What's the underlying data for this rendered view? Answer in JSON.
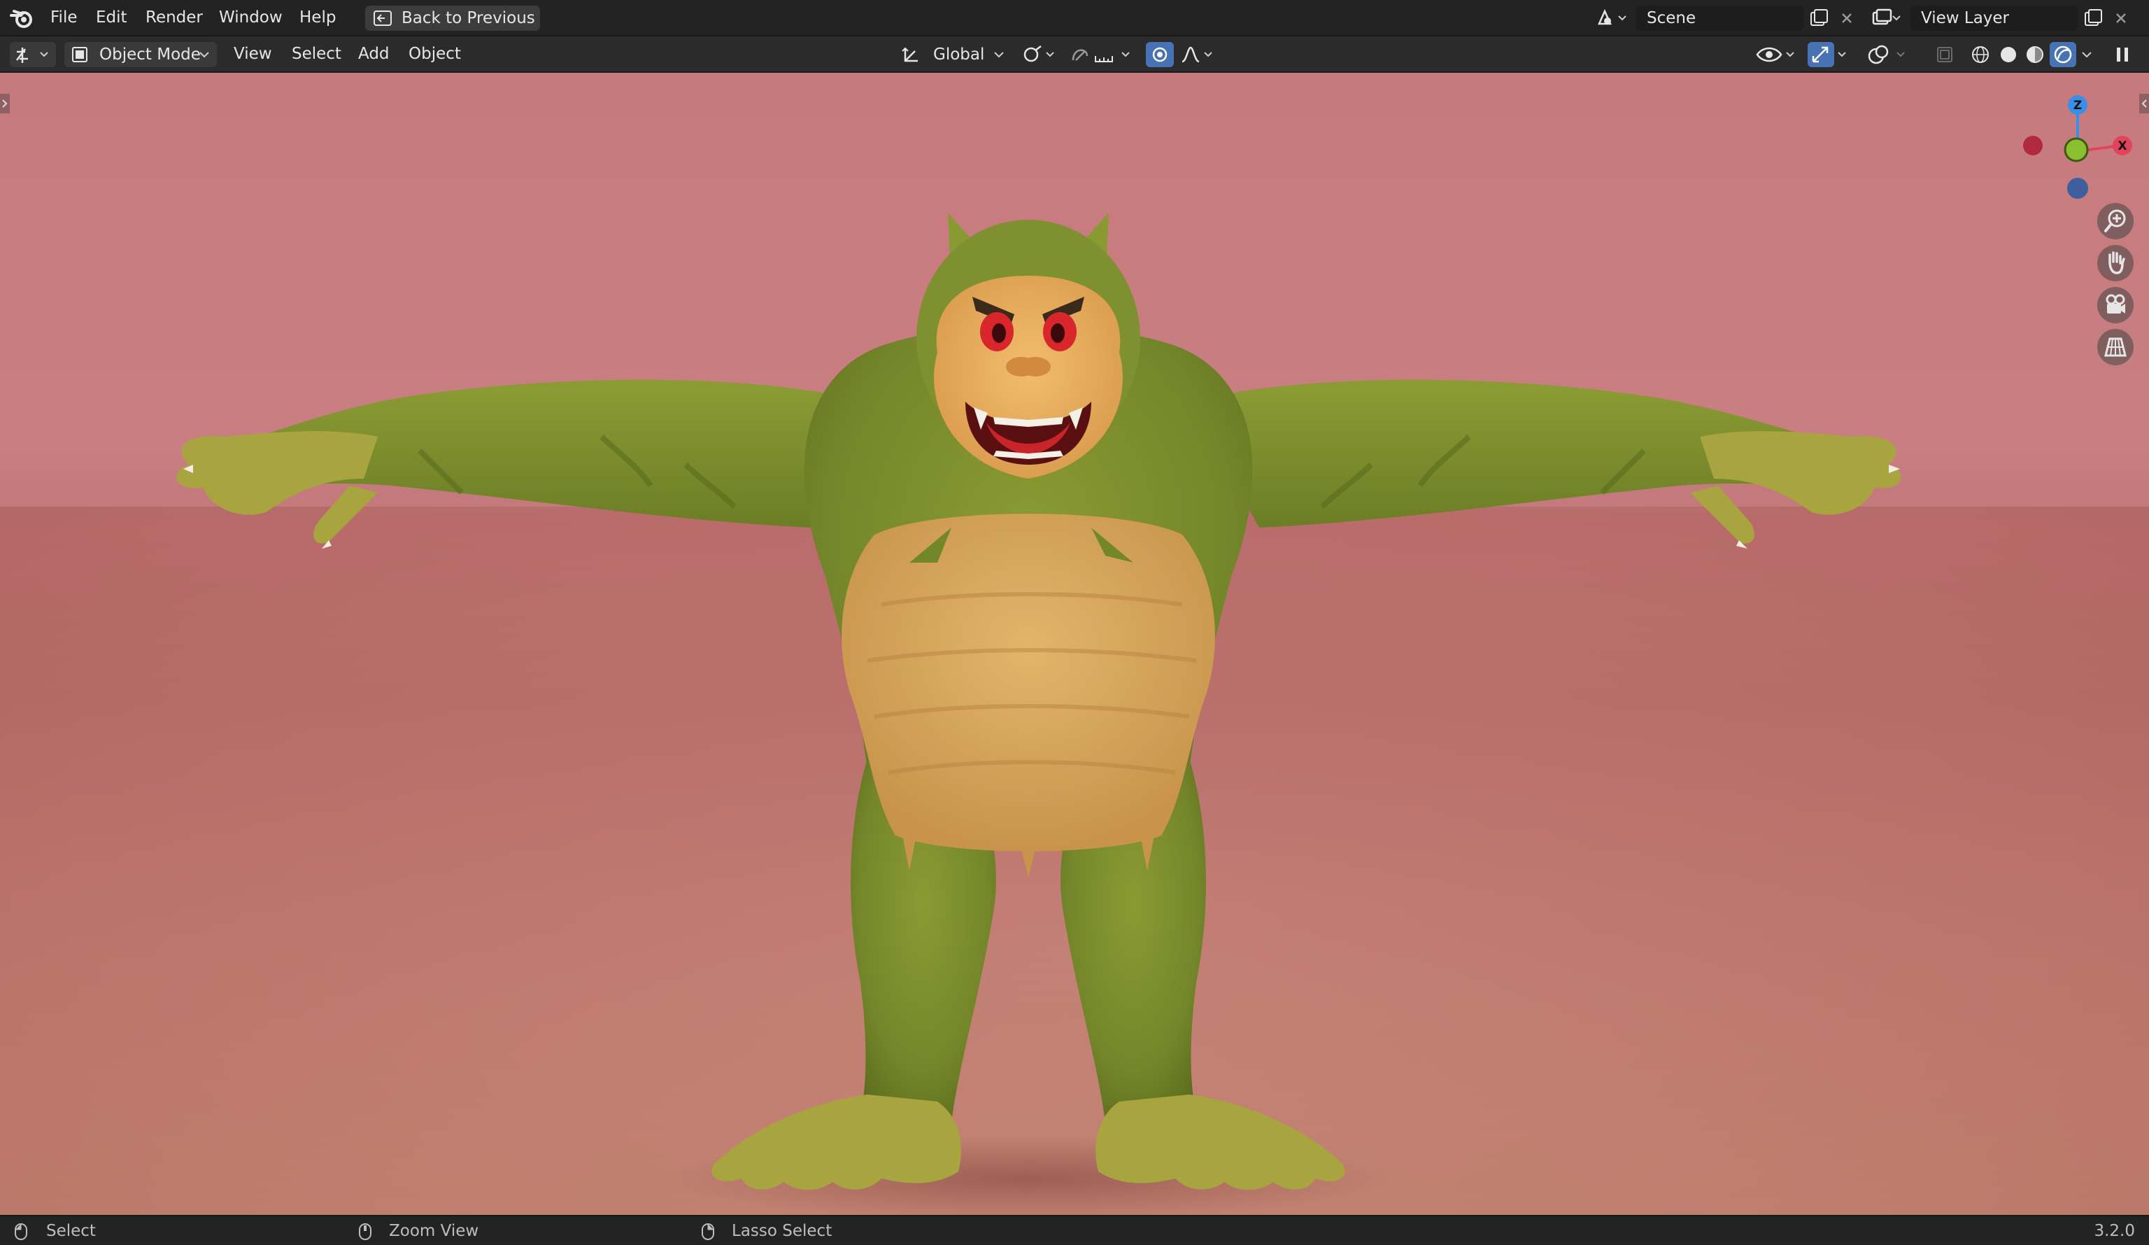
{
  "topbar": {
    "menu": [
      "File",
      "Edit",
      "Render",
      "Window",
      "Help"
    ],
    "back_button": "Back to Previous",
    "scene_name": "Scene",
    "view_layer_name": "View Layer"
  },
  "header": {
    "mode": "Object Mode",
    "menus": [
      "View",
      "Select",
      "Add",
      "Object"
    ],
    "transform_orientation": "Global"
  },
  "gizmo": {
    "z_label": "Z",
    "x_label": "X"
  },
  "statusbar": {
    "left_action": "Select",
    "middle_action": "Zoom View",
    "right_action": "Lasso Select",
    "version": "3.2.0"
  },
  "colors": {
    "viewport_bg": "#c77a7e",
    "creature_green": "#7c8e2c",
    "creature_tan": "#d6a25c",
    "axis_x": "#e2445c",
    "axis_y": "#8bbf30",
    "axis_z": "#3b8ee8",
    "overlay_active": "#4772b3"
  },
  "icons": [
    "blender-logo-icon",
    "back-icon",
    "scene-icon",
    "view-layer-icon",
    "new-icon",
    "close-icon",
    "editor-type-icon",
    "object-mode-icon",
    "orientation-icon",
    "pivot-icon",
    "snap-icon",
    "proportional-icon",
    "visibility-icon",
    "gizmo-icon",
    "overlay-icon",
    "xray-icon",
    "wireframe-icon",
    "solid-icon",
    "material-icon",
    "rendered-icon",
    "zoom-icon",
    "hand-icon",
    "camera-icon",
    "grid-icon",
    "mouse-icon",
    "pause-icon"
  ]
}
